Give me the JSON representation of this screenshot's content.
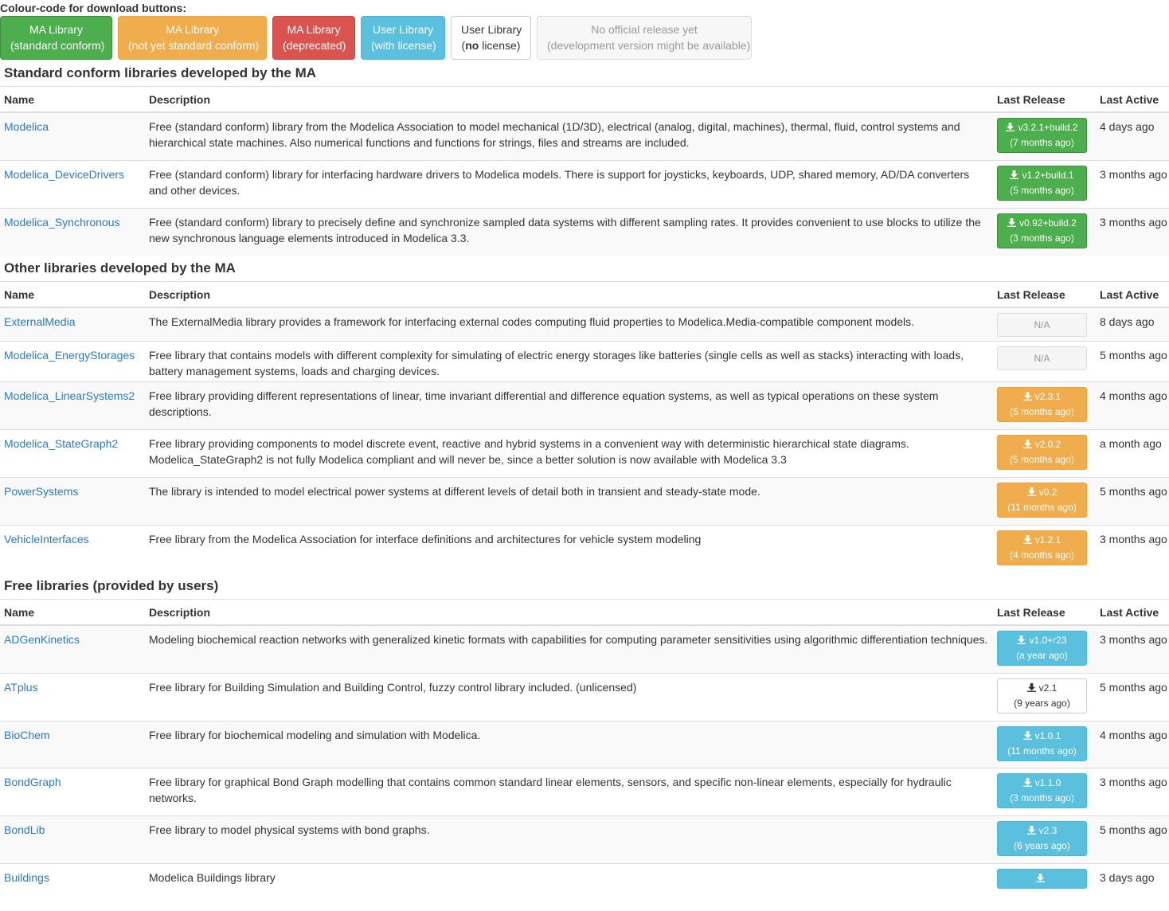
{
  "legend": {
    "title": "Colour-code for download buttons:",
    "items": [
      {
        "line1": "MA Library",
        "line2": "(standard conform)",
        "style": "green"
      },
      {
        "line1": "MA Library",
        "line2": "(not yet standard conform)",
        "style": "orange"
      },
      {
        "line1": "MA Library",
        "line2": "(deprecated)",
        "style": "red"
      },
      {
        "line1": "User Library",
        "line2": "(with license)",
        "style": "blue"
      },
      {
        "line1": "User Library",
        "line2_bold": "no",
        "line2_rest": " license",
        "style": "white"
      },
      {
        "line1": "No official release yet",
        "line2": "(development version might be available)",
        "style": "disabled"
      }
    ]
  },
  "headers": {
    "name": "Name",
    "description": "Description",
    "release": "Last Release",
    "active": "Last Active"
  },
  "sections": [
    {
      "title": "Standard conform libraries developed by the MA",
      "rows": [
        {
          "name": "Modelica",
          "description": "Free (standard conform) library from the Modelica Association to model mechanical (1D/3D), electrical (analog, digital, machines), thermal, fluid, control systems and hierarchical state machines. Also numerical functions and functions for strings, files and streams are included.",
          "version": "v3.2.1+build.2",
          "age": "(7 months ago)",
          "style": "green",
          "active": "4 days ago"
        },
        {
          "name": "Modelica_DeviceDrivers",
          "description": "Free (standard conform) library for interfacing hardware drivers to Modelica models. There is support for joysticks, keyboards, UDP, shared memory, AD/DA converters and other devices.",
          "version": "v1.2+build.1",
          "age": "(5 months ago)",
          "style": "green",
          "active": "3 months ago"
        },
        {
          "name": "Modelica_Synchronous",
          "description": "Free (standard conform) library to precisely define and synchronize sampled data systems with different sampling rates. It provides convenient to use blocks to utilize the new synchronous language elements introduced in Modelica 3.3.",
          "version": "v0.92+build.2",
          "age": "(3 months ago)",
          "style": "green",
          "active": "3 months ago"
        }
      ]
    },
    {
      "title": "Other libraries developed by the MA",
      "rows": [
        {
          "name": "ExternalMedia",
          "description": "The ExternalMedia library provides a framework for interfacing external codes computing fluid properties to Modelica.Media-compatible component models.",
          "version": "N/A",
          "age": "",
          "style": "na",
          "active": "8 days ago"
        },
        {
          "name": "Modelica_EnergyStorages",
          "description": "Free library that contains models with different complexity for simulating of electric energy storages like batteries (single cells as well as stacks) interacting with loads, battery management systems, loads and charging devices.",
          "version": "N/A",
          "age": "",
          "style": "na",
          "active": "5 months ago"
        },
        {
          "name": "Modelica_LinearSystems2",
          "description": "Free library providing different representations of linear, time invariant differential and difference equation systems, as well as typical operations on these system descriptions.",
          "version": "v2.3.1",
          "age": "(5 months ago)",
          "style": "orange",
          "active": "4 months ago"
        },
        {
          "name": "Modelica_StateGraph2",
          "description": "Free library providing components to model discrete event, reactive and hybrid systems in a convenient way with deterministic hierarchical state diagrams. Modelica_StateGraph2 is not fully Modelica compliant and will never be, since a better solution is now available with Modelica 3.3",
          "version": "v2.0.2",
          "age": "(5 months ago)",
          "style": "orange",
          "active": "a month ago"
        },
        {
          "name": "PowerSystems",
          "description": "The library is intended to model electrical power systems at different levels of detail both in transient and steady-state mode.",
          "version": "v0.2",
          "age": "(11 months ago)",
          "style": "orange",
          "active": "5 months ago"
        },
        {
          "name": "VehicleInterfaces",
          "description": "Free library from the Modelica Association for interface definitions and architectures for vehicle system modeling",
          "version": "v1.2.1",
          "age": "(4 months ago)",
          "style": "orange",
          "active": "3 months ago"
        }
      ]
    },
    {
      "title": "Free libraries (provided by users)",
      "rows": [
        {
          "name": "ADGenKinetics",
          "description": "Modeling biochemical reaction networks with generalized kinetic formats with capabilities for computing parameter sensitivities using algorithmic differentiation techniques.",
          "version": "v1.0+r23",
          "age": "(a year ago)",
          "style": "blue",
          "active": "3 months ago"
        },
        {
          "name": "ATplus",
          "description": "Free library for Building Simulation and Building Control, fuzzy control library included. (unlicensed)",
          "version": "v2.1",
          "age": "(9 years ago)",
          "style": "white",
          "active": "5 months ago"
        },
        {
          "name": "BioChem",
          "description": "Free library for biochemical modeling and simulation with Modelica.",
          "version": "v1.0.1",
          "age": "(11 months ago)",
          "style": "blue",
          "active": "4 months ago"
        },
        {
          "name": "BondGraph",
          "description": "Free library for graphical Bond Graph modelling that contains common standard linear elements, sensors, and specific non-linear elements, especially for hydraulic networks.",
          "version": "v1.1.0",
          "age": "(3 months ago)",
          "style": "blue",
          "active": "3 months ago"
        },
        {
          "name": "BondLib",
          "description": "Free library to model physical systems with bond graphs.",
          "version": "v2.3",
          "age": "(6 years ago)",
          "style": "blue",
          "active": "5 months ago"
        },
        {
          "name": "Buildings",
          "description": "Modelica Buildings library",
          "version": "",
          "age": "",
          "style": "blue",
          "active": "3 days ago"
        }
      ]
    }
  ]
}
